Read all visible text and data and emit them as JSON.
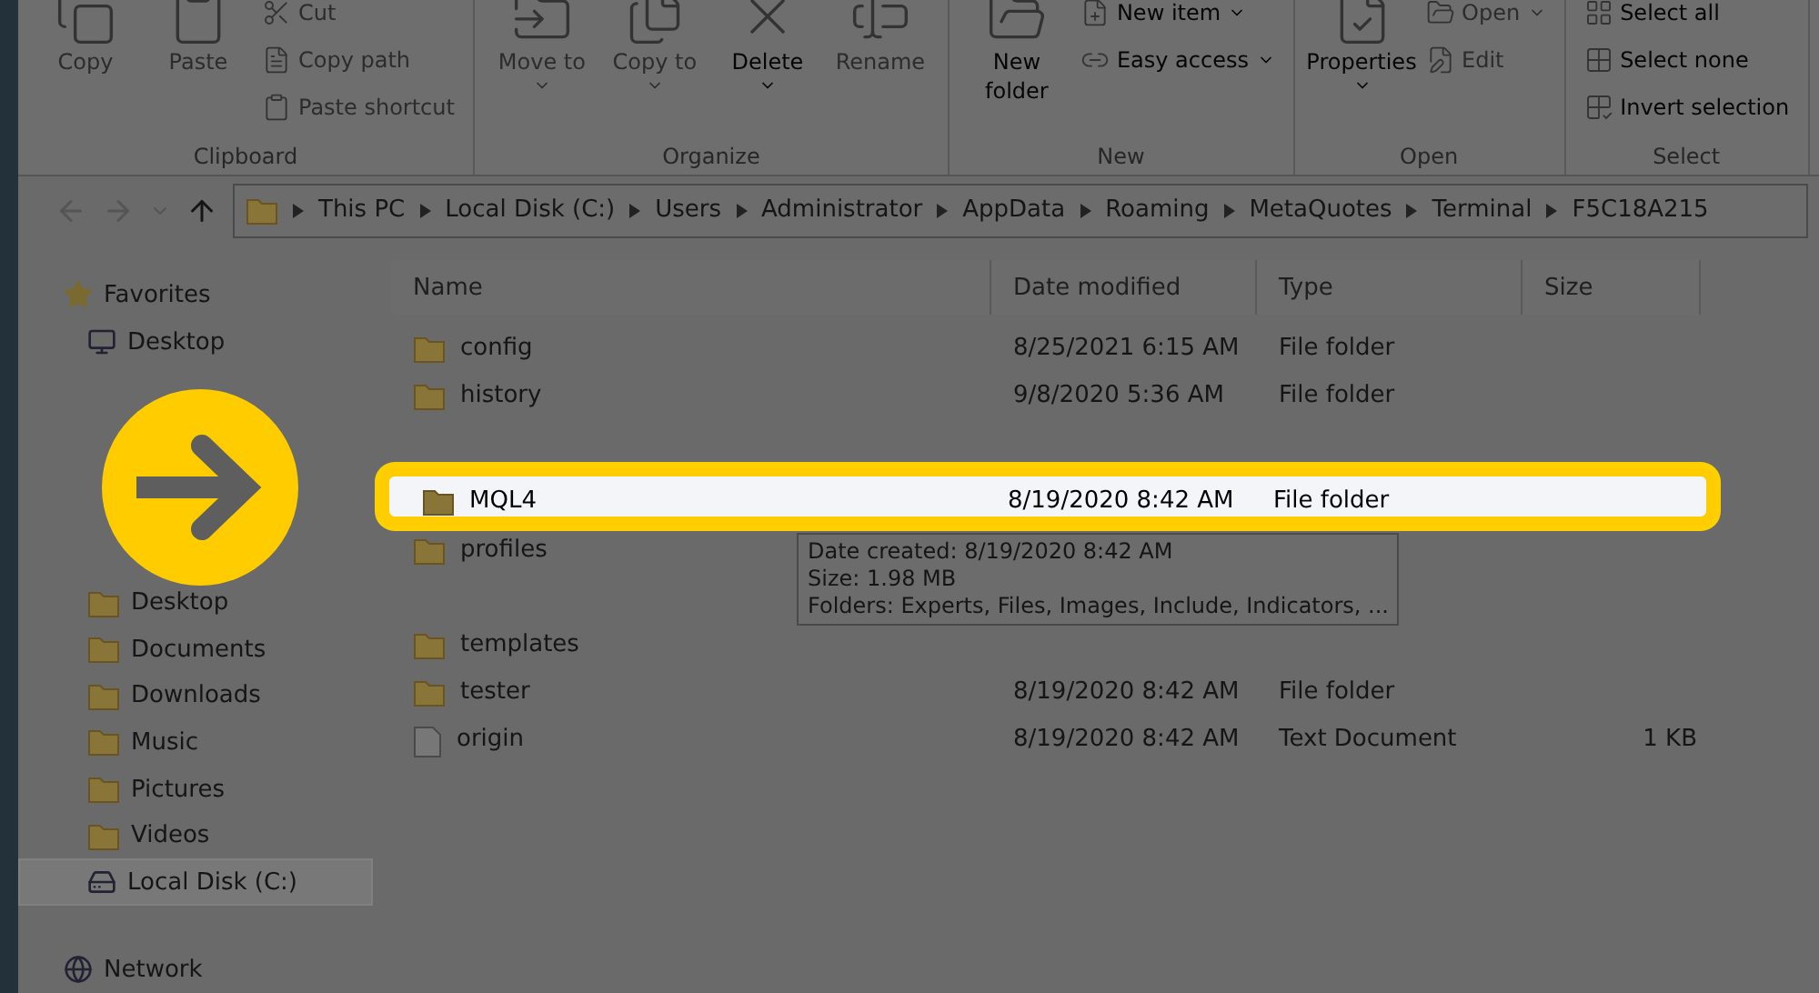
{
  "ribbon": {
    "groups": [
      {
        "label": "Clipboard",
        "large": [
          {
            "label": "Copy",
            "disabled": true
          },
          {
            "label": "Paste",
            "disabled": true
          }
        ],
        "small": [
          {
            "label": "Cut",
            "disabled": true
          },
          {
            "label": "Copy path",
            "disabled": true
          },
          {
            "label": "Paste shortcut",
            "disabled": true
          }
        ]
      },
      {
        "label": "Organize",
        "large": [
          {
            "label": "Move to",
            "disabled": true,
            "dropdown": true
          },
          {
            "label": "Copy to",
            "disabled": true,
            "dropdown": true
          },
          {
            "label": "Delete",
            "disabled": false,
            "dropdown": true
          },
          {
            "label": "Rename",
            "disabled": true
          }
        ]
      },
      {
        "label": "New",
        "large": [
          {
            "label": "New folder",
            "disabled": false
          }
        ],
        "small": [
          {
            "label": "New item",
            "disabled": false,
            "dropdown": true
          },
          {
            "label": "Easy access",
            "disabled": false,
            "dropdown": true
          }
        ]
      },
      {
        "label": "Open",
        "large": [
          {
            "label": "Properties",
            "disabled": false,
            "dropdown": true
          }
        ],
        "small": [
          {
            "label": "Open",
            "disabled": true,
            "dropdown": true
          },
          {
            "label": "Edit",
            "disabled": true
          }
        ]
      },
      {
        "label": "Select",
        "small": [
          {
            "label": "Select all",
            "disabled": false
          },
          {
            "label": "Select none",
            "disabled": false
          },
          {
            "label": "Invert selection",
            "disabled": false
          }
        ]
      }
    ]
  },
  "address": {
    "segments": [
      "This PC",
      "Local Disk (C:)",
      "Users",
      "Administrator",
      "AppData",
      "Roaming",
      "MetaQuotes",
      "Terminal",
      "F5C18A215"
    ]
  },
  "sidebar": {
    "sections": [
      {
        "label": "Favorites",
        "kind": "star",
        "items": [
          {
            "label": "Desktop",
            "selected": false
          }
        ]
      },
      {
        "kind": "gap"
      },
      {
        "kind": "pc",
        "items": [
          {
            "label": "Desktop",
            "selected": false
          },
          {
            "label": "Documents",
            "selected": false
          },
          {
            "label": "Downloads",
            "selected": false
          },
          {
            "label": "Music",
            "selected": false
          },
          {
            "label": "Pictures",
            "selected": false
          },
          {
            "label": "Videos",
            "selected": false
          },
          {
            "label": "Local Disk (C:)",
            "selected": true
          }
        ]
      },
      {
        "label": "Network",
        "kind": "network"
      }
    ]
  },
  "table": {
    "columns": [
      "Name",
      "Date modified",
      "Type",
      "Size"
    ],
    "rows": [
      {
        "kind": "folder",
        "name": "config",
        "date": "8/25/2021 6:15 AM",
        "type": "File folder",
        "highlighted": false
      },
      {
        "kind": "folder",
        "name": "history",
        "date": "9/8/2020 5:36 AM",
        "type": "File folder",
        "highlighted": false
      },
      {
        "kind": "folder",
        "name": "MQL4",
        "date": "8/19/2020 8:42 AM",
        "type": "File folder",
        "highlighted": true
      },
      {
        "kind": "folder",
        "name": "profiles",
        "highlighted": false,
        "tooltip": [
          "Date created: 8/19/2020 8:42 AM",
          "Size: 1.98 MB",
          "Folders: Experts, Files, Images, Include, Indicators, ..."
        ]
      },
      {
        "kind": "folder",
        "name": "templates",
        "highlighted": false
      },
      {
        "kind": "folder",
        "name": "tester",
        "date": "8/19/2020 8:42 AM",
        "type": "File folder",
        "highlighted": false
      },
      {
        "kind": "file",
        "name": "origin",
        "date": "8/19/2020 8:42 AM",
        "type": "Text Document",
        "size": "1 KB",
        "highlighted": false
      }
    ]
  }
}
